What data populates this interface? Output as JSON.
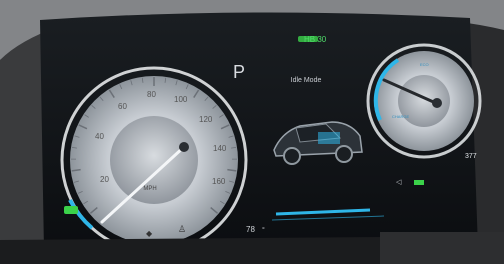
{
  "cluster": {
    "gear": "P",
    "drive_mode": "Idle Mode",
    "top_status": "HB 30",
    "range": "377",
    "temperature": "78",
    "accent_color": "#2fb6e8",
    "indicator_color": "#3bd24a",
    "speedometer": {
      "unit": "MPH",
      "ticks": [
        "20",
        "40",
        "60",
        "80",
        "100",
        "120",
        "140",
        "160"
      ],
      "needle_value": 0
    },
    "power_gauge": {
      "labels": [
        "ECO",
        "CHARGE"
      ],
      "needle_value": 0
    },
    "icons": [
      "car-silhouette-icon",
      "sign-icon",
      "seatbelt-icon",
      "speaker-icon",
      "green-indicator-icon"
    ]
  }
}
